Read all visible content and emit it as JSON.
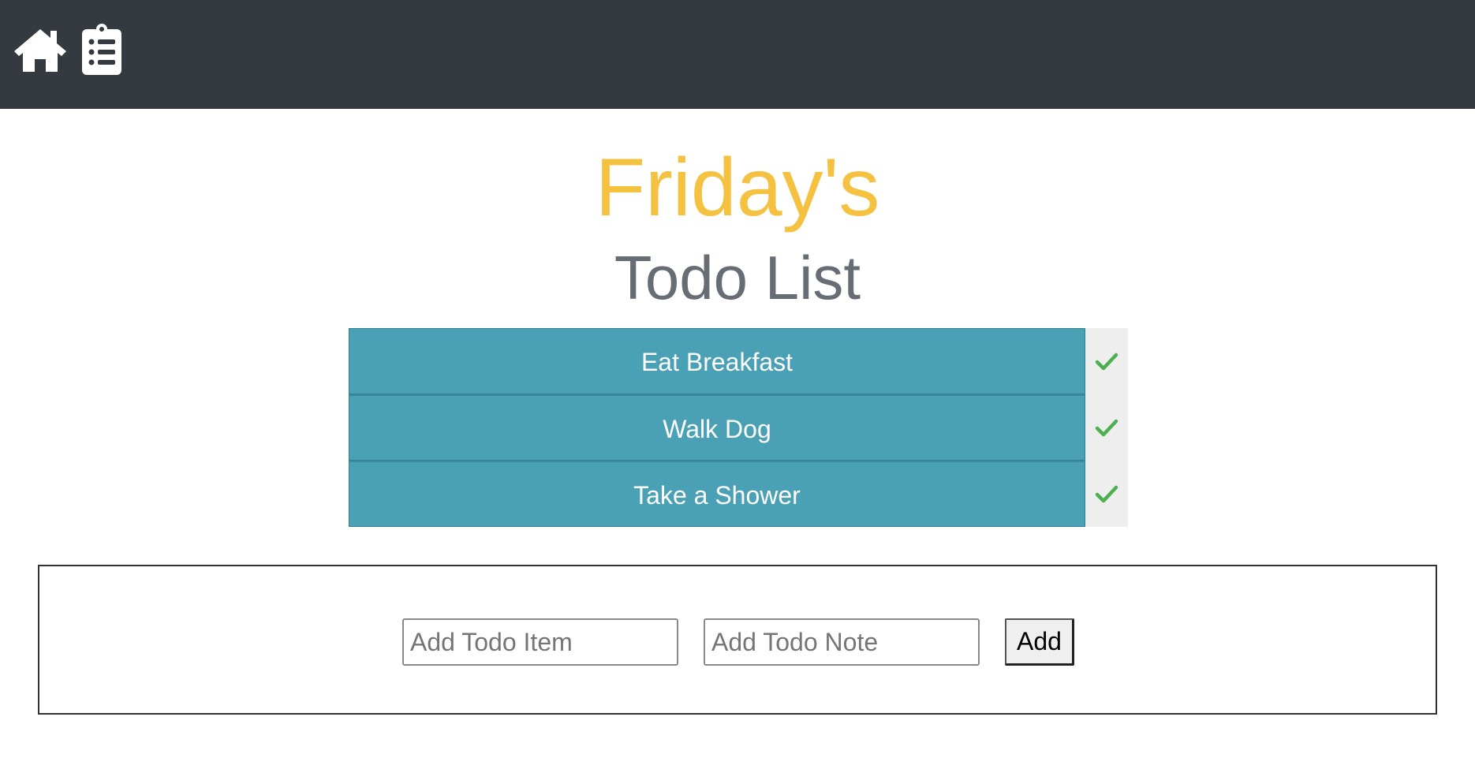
{
  "navbar": {
    "icons": [
      "home-icon",
      "clipboard-list-icon"
    ],
    "background_color": "#343a40"
  },
  "header": {
    "day": "Friday's",
    "title": "Todo List",
    "day_color": "#f4c141",
    "title_color": "#666d75"
  },
  "todos": [
    {
      "label": "Eat Breakfast",
      "status_icon": "check-icon"
    },
    {
      "label": "Walk Dog",
      "status_icon": "check-icon"
    },
    {
      "label": "Take a Shower",
      "status_icon": "check-icon"
    }
  ],
  "todo_colors": {
    "item_background": "#4aa0b5",
    "check_color": "#4caf50"
  },
  "add_form": {
    "item_input": {
      "value": "",
      "placeholder": "Add Todo Item"
    },
    "note_input": {
      "value": "",
      "placeholder": "Add Todo Note"
    },
    "add_label": "Add"
  }
}
